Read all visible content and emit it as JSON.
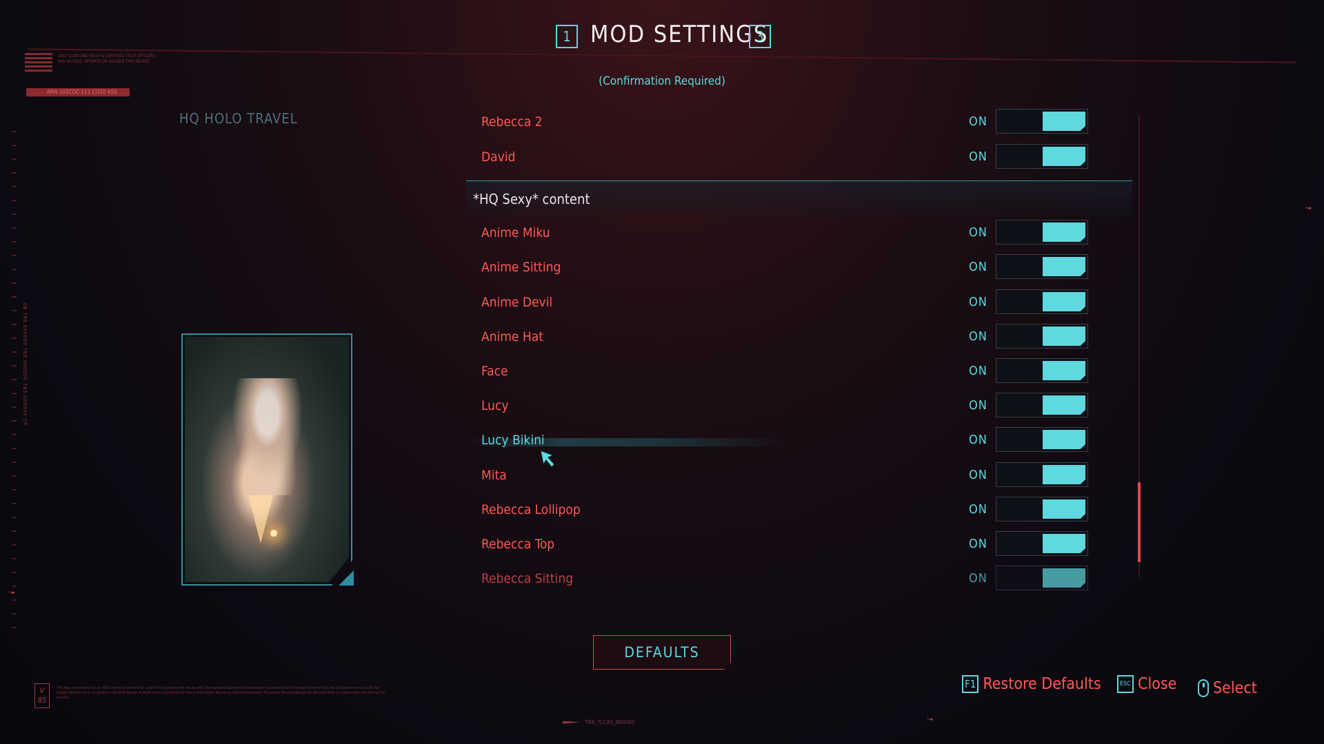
{
  "header": {
    "title": "MOD SETTINGS",
    "prev_key": "1",
    "next_key": "3",
    "confirmation": "(Confirmation Required)"
  },
  "side": {
    "section_label": "HQ HOLO TRAVEL",
    "deco_text": "ONLY CODE AND BODY & CERTIFIED TECH OFFICERS MAY ACCESS. OPERATE OR DISABLE THIS DEVICE.",
    "deco_bar": "ARN 102COC-111 CO10 A55",
    "deco_vertical": "0B 7B5.000000 7B5.000000 7B5.000000 CP",
    "version": "V 85"
  },
  "settings": {
    "rows_top": [
      {
        "label": "Rebecca 2",
        "value": "ON",
        "on": true
      },
      {
        "label": "David",
        "value": "ON",
        "on": true
      }
    ],
    "group_title": "*HQ Sexy* content",
    "rows_group": [
      {
        "label": "Anime Miku",
        "value": "ON",
        "on": true
      },
      {
        "label": "Anime Sitting",
        "value": "ON",
        "on": true
      },
      {
        "label": "Anime Devil",
        "value": "ON",
        "on": true
      },
      {
        "label": "Anime Hat",
        "value": "ON",
        "on": true
      },
      {
        "label": "Face",
        "value": "ON",
        "on": true
      },
      {
        "label": "Lucy",
        "value": "ON",
        "on": true
      },
      {
        "label": "Lucy Bikini",
        "value": "ON",
        "on": true,
        "hovered": true
      },
      {
        "label": "Mita",
        "value": "ON",
        "on": true
      },
      {
        "label": "Rebecca Lollipop",
        "value": "ON",
        "on": true
      },
      {
        "label": "Rebecca Top",
        "value": "ON",
        "on": true
      },
      {
        "label": "Rebecca Sitting",
        "value": "ON",
        "on": true
      }
    ]
  },
  "footer": {
    "defaults_button": "DEFAULTS",
    "restore_key": "F1",
    "restore_label": "Restore Defaults",
    "close_key": "ESC",
    "close_label": "Close",
    "select_label": "Select",
    "bottom_tag": "TRN_TLCA5_800095",
    "legal": "This data was entered on an ADDO terminal and with be used for the purpose and not be sold. Your personal data will be processed in accordance with the Road Personal Data Act of Government and with Tax Subject Records Act in accordance with ADD Maxam Ai-Band and by Guidelines for Use of Information Resources and Personalization Procedure. Personal details are obtained from no preservation but without the consent."
  },
  "colors": {
    "accent_red": "#ff5a55",
    "accent_cyan": "#5fd8e0",
    "title_white": "#f3eeee"
  }
}
